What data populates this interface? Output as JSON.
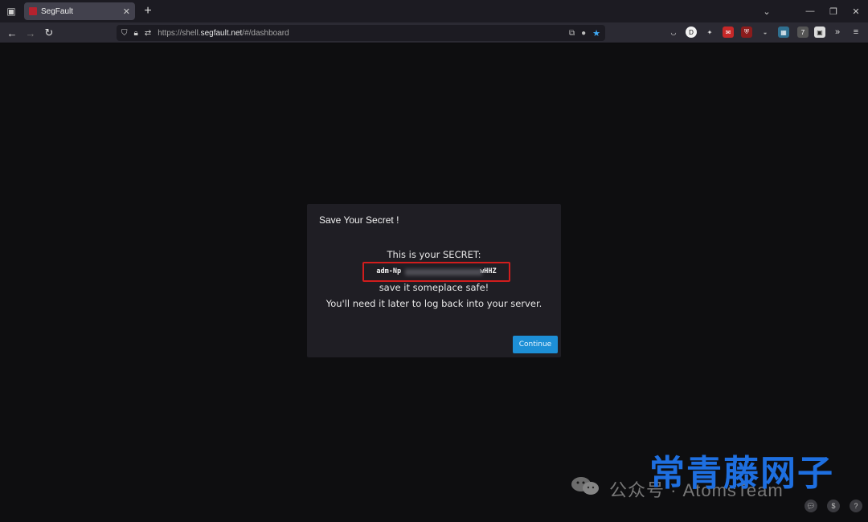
{
  "browser": {
    "tab_title": "SegFault",
    "tab_close": "✕",
    "new_tab": "+",
    "url_prefix": "https://shell.",
    "url_host": "segfault.net",
    "url_path": "/#/dashboard",
    "window_controls": [
      "⌄",
      "—",
      "❐",
      "✕"
    ]
  },
  "modal": {
    "title": "Save Your Secret !",
    "intro": "This is your SECRET:",
    "secret_start": "adm-Np",
    "secret_end": "wHHZ",
    "save_text": "save it someplace safe!",
    "need_text": "You'll need it later to log back into your server.",
    "continue_label": "Continue"
  },
  "watermark": {
    "channel": "公众号 · AtomsTeam",
    "brand": "常青藤网子"
  },
  "colors": {
    "accent": "#1d8fd6",
    "highlight_border": "#d11d1d",
    "page_bg": "#0e0e10",
    "modal_bg": "#1f1e24"
  }
}
